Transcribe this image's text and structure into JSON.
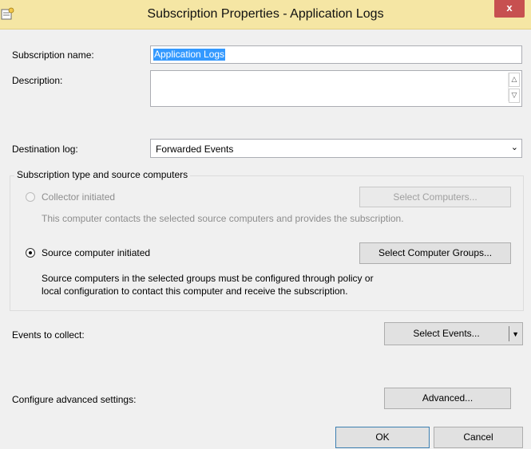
{
  "window": {
    "title": "Subscription Properties - Application Logs",
    "close_glyph": "x",
    "icon": "subscription-wizard-icon"
  },
  "form": {
    "subscription_name_label": "Subscription name:",
    "subscription_name_value": "Application Logs",
    "description_label": "Description:",
    "description_value": "",
    "destination_log_label": "Destination log:",
    "destination_log_value": "Forwarded Events"
  },
  "subscription_type": {
    "caption": "Subscription type and source computers",
    "collector_initiated_label": "Collector initiated",
    "collector_initiated_selected": false,
    "select_computers_label": "Select Computers...",
    "collector_description": "This computer contacts the selected source computers and provides the subscription.",
    "source_initiated_label": "Source computer initiated",
    "source_initiated_selected": true,
    "select_groups_label": "Select Computer Groups...",
    "source_description_line1": "Source computers in the selected groups must be configured through policy or",
    "source_description_line2": "local configuration to contact this computer and receive the subscription."
  },
  "events": {
    "label": "Events to collect:",
    "select_events_label": "Select Events..."
  },
  "advanced": {
    "label": "Configure advanced settings:",
    "button_label": "Advanced..."
  },
  "footer": {
    "ok_label": "OK",
    "cancel_label": "Cancel"
  },
  "colors": {
    "title_bar": "#f5e6a4",
    "close_button": "#c75050",
    "selection": "#3399ff",
    "dialog_bg": "#f0f0f0"
  }
}
